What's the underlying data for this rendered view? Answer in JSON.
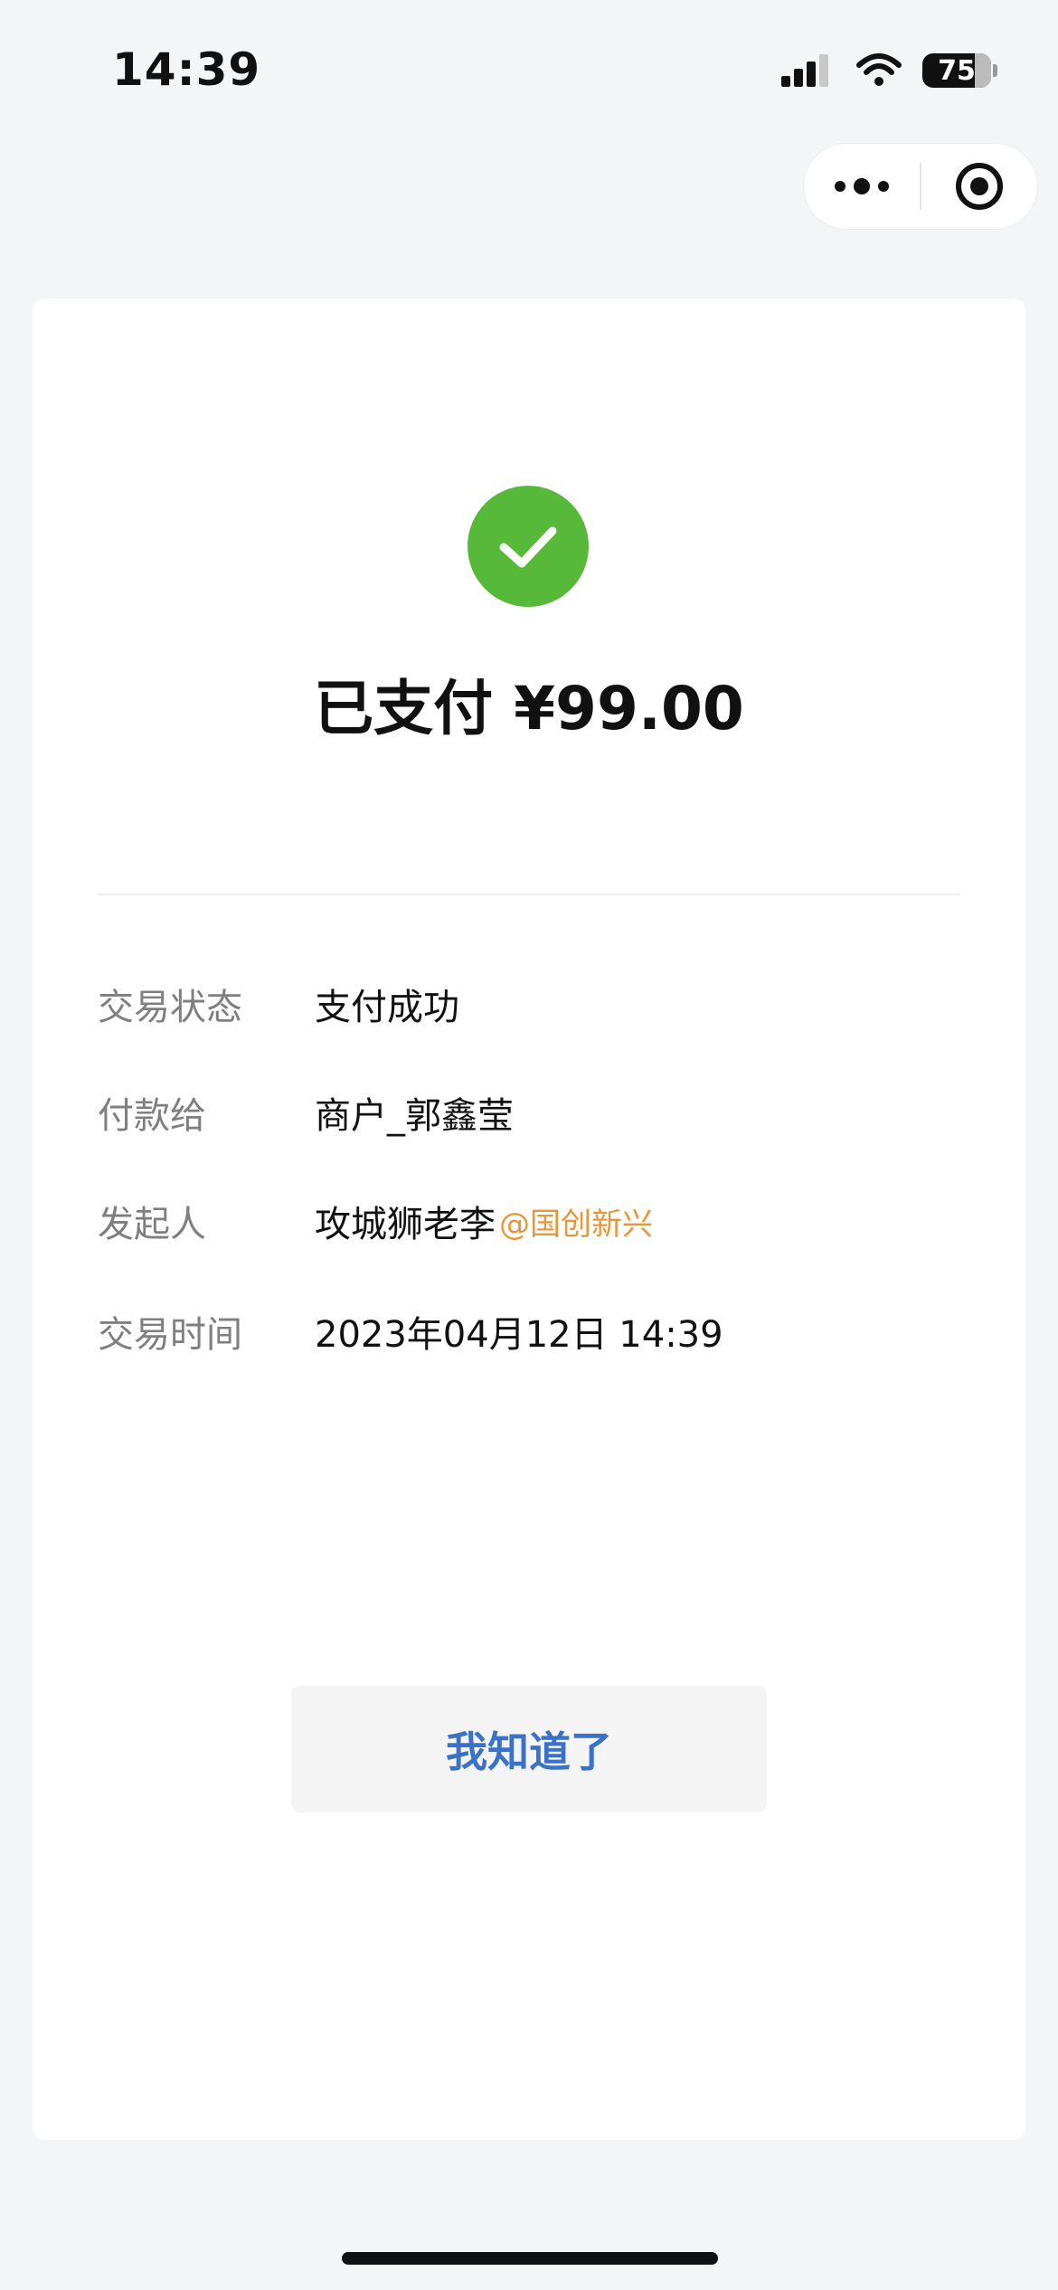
{
  "status_bar": {
    "time": "14:39",
    "battery": "75"
  },
  "capsule": {
    "more_icon": "more-dots-icon",
    "close_icon": "target-icon"
  },
  "payment": {
    "title": "已支付 ¥99.00",
    "status_color": "#57b93a"
  },
  "details": [
    {
      "label": "交易状态",
      "value": "支付成功",
      "suffix": ""
    },
    {
      "label": "付款给",
      "value": "商户_郭鑫莹",
      "suffix": ""
    },
    {
      "label": "发起人",
      "value": "攻城狮老李",
      "suffix": "@国创新兴"
    },
    {
      "label": "交易时间",
      "value": "2023年04月12日 14:39",
      "suffix": ""
    }
  ],
  "button": {
    "label": "我知道了",
    "color": "#3b72c9"
  }
}
